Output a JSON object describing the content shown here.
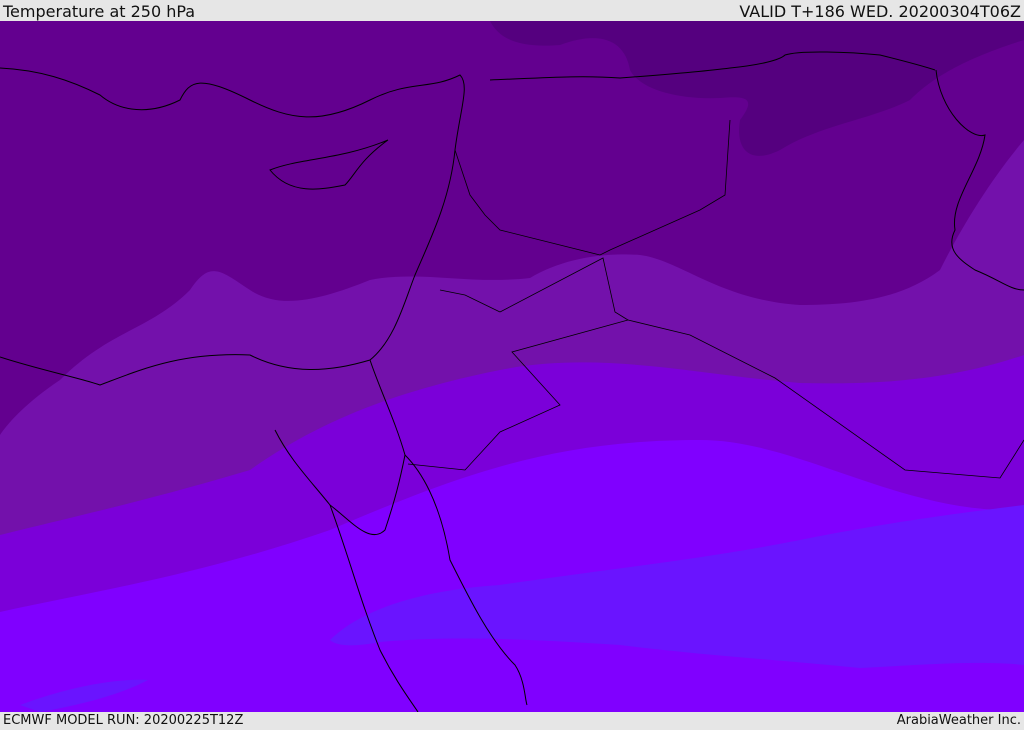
{
  "header": {
    "title": "Temperature at 250 hPa",
    "valid": "VALID T+186 WED. 20200304T06Z"
  },
  "footer": {
    "model_run": "ECMWF MODEL RUN: 20200225T12Z",
    "credit": "ArabiaWeather Inc."
  },
  "legend_colors": [
    "#55007f",
    "#63008f",
    "#7311ab",
    "#7b00d9",
    "#8000ff",
    "#6a14ff"
  ]
}
